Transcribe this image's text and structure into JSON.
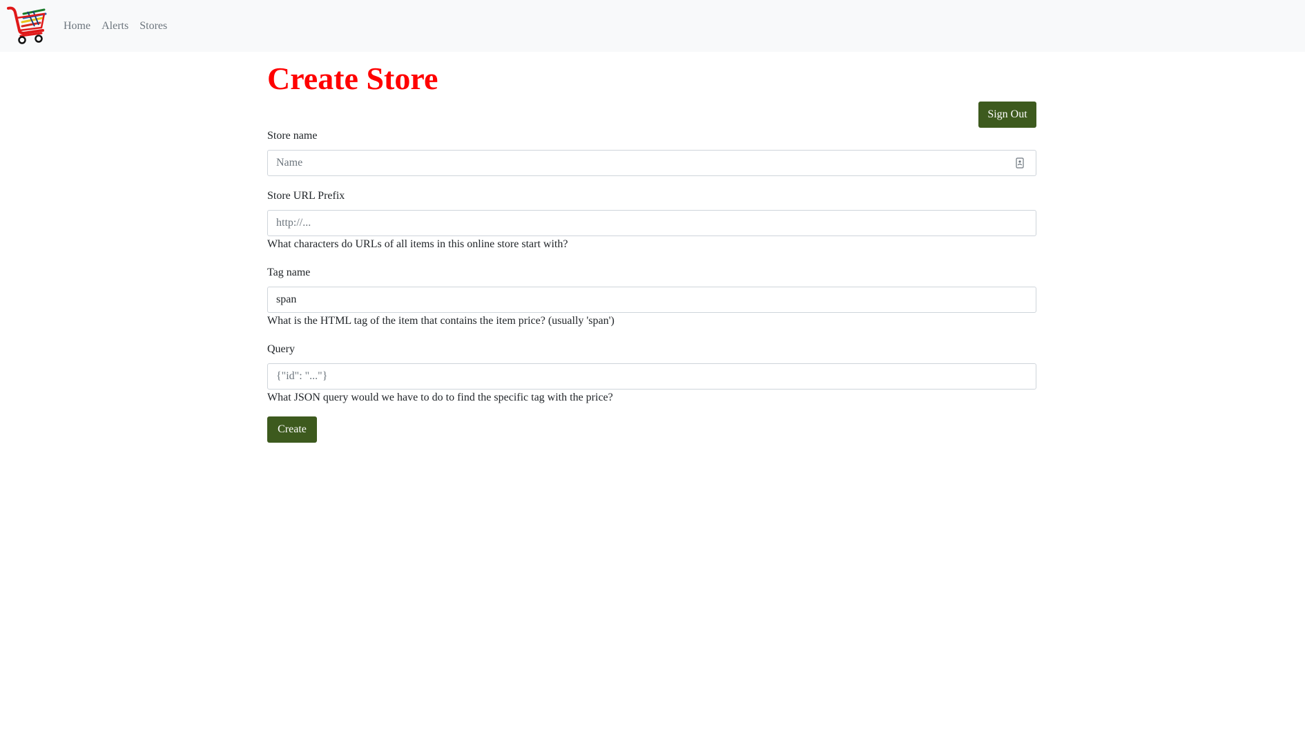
{
  "nav": {
    "logo_icon": "shopping-cart-logo",
    "links": [
      "Home",
      "Alerts",
      "Stores"
    ]
  },
  "page": {
    "title": "Create Store",
    "title_color": "#ff0000",
    "signout_label": "Sign Out",
    "button_color": "#3d5a1e"
  },
  "form": {
    "store_name": {
      "label": "Store name",
      "placeholder": "Name",
      "value": ""
    },
    "url_prefix": {
      "label": "Store URL Prefix",
      "placeholder": "http://...",
      "value": "",
      "help": "What characters do URLs of all items in this online store start with?"
    },
    "tag_name": {
      "label": "Tag name",
      "placeholder": "",
      "value": "span",
      "help": "What is the HTML tag of the item that contains the item price? (usually 'span')"
    },
    "query": {
      "label": "Query",
      "placeholder": "{\"id\": \"...\"}",
      "value": "",
      "help": "What JSON query would we have to do to find the specific tag with the price?"
    },
    "submit_label": "Create"
  }
}
